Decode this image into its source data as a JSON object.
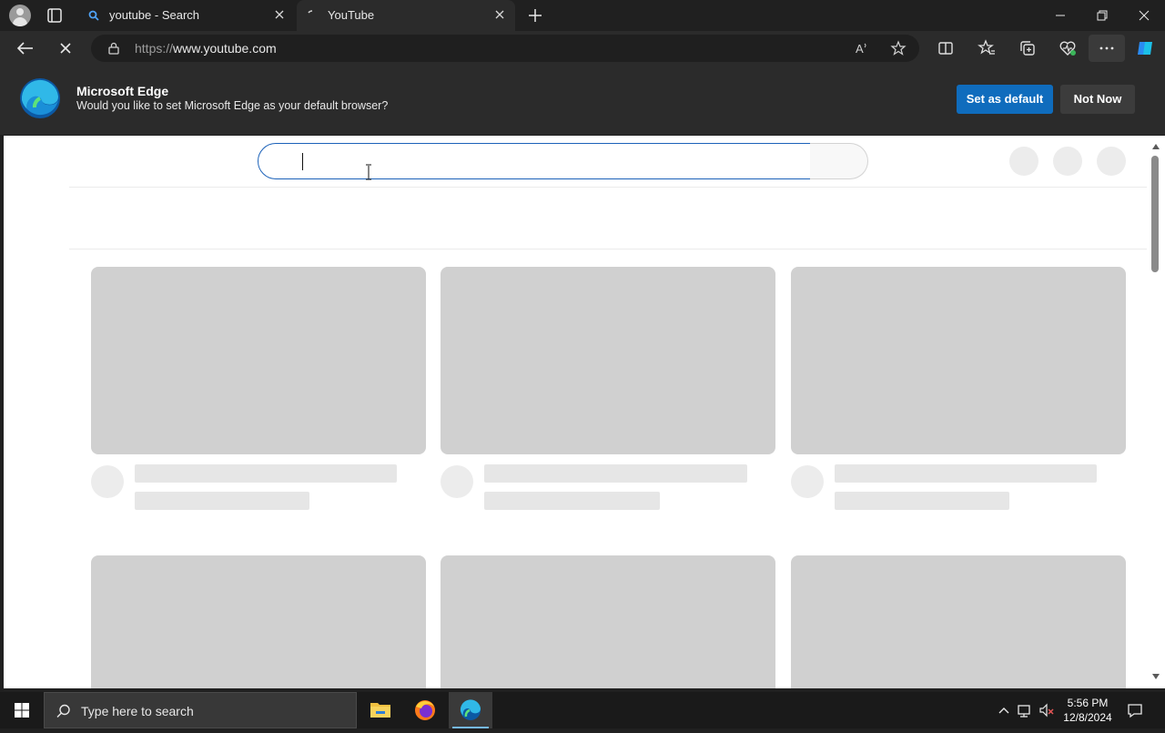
{
  "browser": {
    "tabs": [
      {
        "title": "youtube - Search",
        "favicon": "search-icon"
      },
      {
        "title": "YouTube",
        "favicon": "loading-icon"
      }
    ],
    "url_scheme": "https://",
    "url_host": "www.youtube.com",
    "toolbar_icons": [
      "back-icon",
      "stop-loading-icon",
      "lock-icon",
      "read-aloud-icon",
      "favorite-star-icon",
      "split-screen-icon",
      "favorites-icon",
      "collections-icon",
      "browser-essentials-icon",
      "more-icon",
      "copilot-icon"
    ]
  },
  "infobar": {
    "title": "Microsoft Edge",
    "message": "Would you like to set Microsoft Edge as your default browser?",
    "primary_button": "Set as default",
    "secondary_button": "Not Now"
  },
  "page": {
    "state": "loading-skeleton"
  },
  "taskbar": {
    "search_placeholder": "Type here to search",
    "apps": [
      "file-explorer-icon",
      "firefox-icon",
      "edge-icon"
    ],
    "time": "5:56 PM",
    "date": "12/8/2024"
  },
  "colors": {
    "accent": "#0f6cbd",
    "search_border": "#1c62b9",
    "skeleton": "#d0d0d0"
  }
}
